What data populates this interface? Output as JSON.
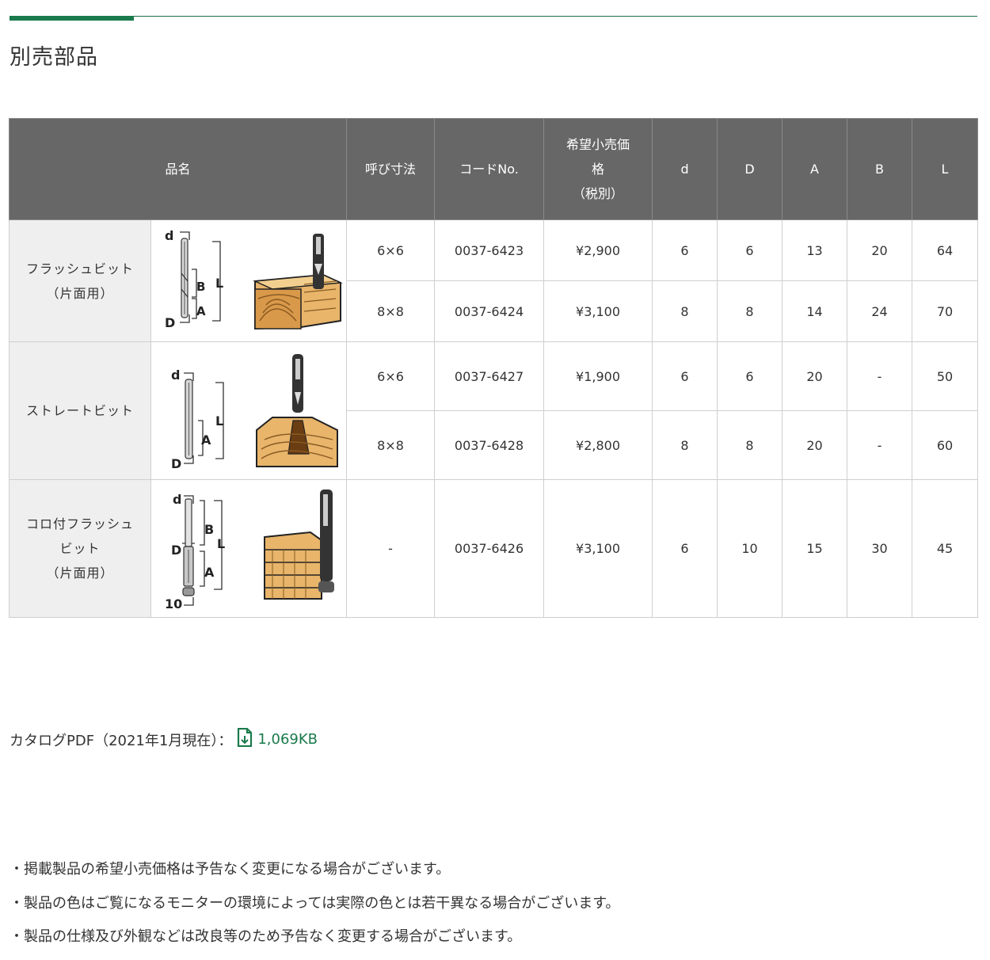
{
  "page": {
    "title": "別売部品"
  },
  "table": {
    "headers": {
      "name": "品名",
      "size": "呼び寸法",
      "code": "コードNo.",
      "price_lines": [
        "希望小売価",
        "格",
        "（税別）"
      ],
      "d": "d",
      "D": "D",
      "A": "A",
      "B": "B",
      "L": "L"
    },
    "groups": [
      {
        "name_lines": [
          "フラッシュビット",
          "（片面用）"
        ],
        "diagram_labels": [
          "d",
          "B",
          "L",
          "A",
          "D"
        ],
        "rows": [
          {
            "size": "6×6",
            "code": "0037-6423",
            "price": "¥2,900",
            "d": "6",
            "D": "6",
            "A": "13",
            "B": "20",
            "L": "64"
          },
          {
            "size": "8×8",
            "code": "0037-6424",
            "price": "¥3,100",
            "d": "8",
            "D": "8",
            "A": "14",
            "B": "24",
            "L": "70"
          }
        ]
      },
      {
        "name_lines": [
          "ストレートビット"
        ],
        "diagram_labels": [
          "d",
          "L",
          "A",
          "D"
        ],
        "rows": [
          {
            "size": "6×6",
            "code": "0037-6427",
            "price": "¥1,900",
            "d": "6",
            "D": "6",
            "A": "20",
            "B": "-",
            "L": "50"
          },
          {
            "size": "8×8",
            "code": "0037-6428",
            "price": "¥2,800",
            "d": "8",
            "D": "8",
            "A": "20",
            "B": "-",
            "L": "60"
          }
        ]
      },
      {
        "name_lines": [
          "コロ付フラッシュ",
          "ビット",
          "（片面用）"
        ],
        "diagram_labels": [
          "d",
          "B",
          "L",
          "D",
          "A",
          "10"
        ],
        "rows": [
          {
            "size": "-",
            "code": "0037-6426",
            "price": "¥3,100",
            "d": "6",
            "D": "10",
            "A": "15",
            "B": "30",
            "L": "45"
          }
        ]
      }
    ]
  },
  "catalog": {
    "label": "カタログPDF（2021年1月現在）：",
    "size": "1,069KB",
    "icon": "pdf-file-icon",
    "link_color": "#1a7a4c"
  },
  "notes": [
    "・掲載製品の希望小売価格は予告なく変更になる場合がございます。",
    "・製品の色はご覧になるモニターの環境によっては実際の色とは若干異なる場合がございます。",
    "・製品の仕様及び外観などは改良等のため予告なく変更する場合がございます。"
  ],
  "colors": {
    "accent": "#1a7a4c",
    "header_bg": "#676767",
    "name_cell_bg": "#efefef"
  }
}
